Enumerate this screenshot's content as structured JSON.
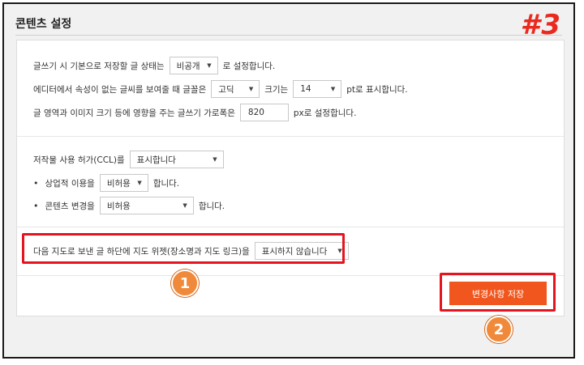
{
  "title": "콘텐츠 설정",
  "step_tag": "#3",
  "section1": {
    "row1": {
      "prefix": "글쓰기 시 기본으로 저장할 글 상태는",
      "select": "비공개",
      "suffix": "로 설정합니다."
    },
    "row2": {
      "prefix": "에디터에서 속성이 없는 글씨를 보여줄 때 글꼴은",
      "font_select": "고딕",
      "mid": "크기는",
      "size_select": "14",
      "suffix": "pt로 표시합니다."
    },
    "row3": {
      "prefix": "글 영역과 이미지 크기 등에 영향을 주는 글쓰기 가로폭은",
      "value": "820",
      "suffix": "px로 설정합니다."
    }
  },
  "section2": {
    "row1": {
      "prefix": "저작물 사용 허가(CCL)를",
      "select": "표시합니다"
    },
    "row2": {
      "bullet": "•",
      "prefix": "상업적 이용을",
      "select": "비허용",
      "suffix": "합니다."
    },
    "row3": {
      "bullet": "•",
      "prefix": "콘텐츠 변경을",
      "select": "비허용",
      "suffix": "합니다."
    }
  },
  "section3": {
    "row1": {
      "prefix": "다음 지도로 보낸 글 하단에 지도 위젯(장소명과 지도 링크)을",
      "select": "표시하지 않습니다"
    }
  },
  "save_button": "변경사항 저장",
  "badges": {
    "one": "1",
    "two": "2"
  },
  "colors": {
    "accent": "#f0561d",
    "highlight": "#e5141f",
    "badge": "#f08a3a"
  }
}
